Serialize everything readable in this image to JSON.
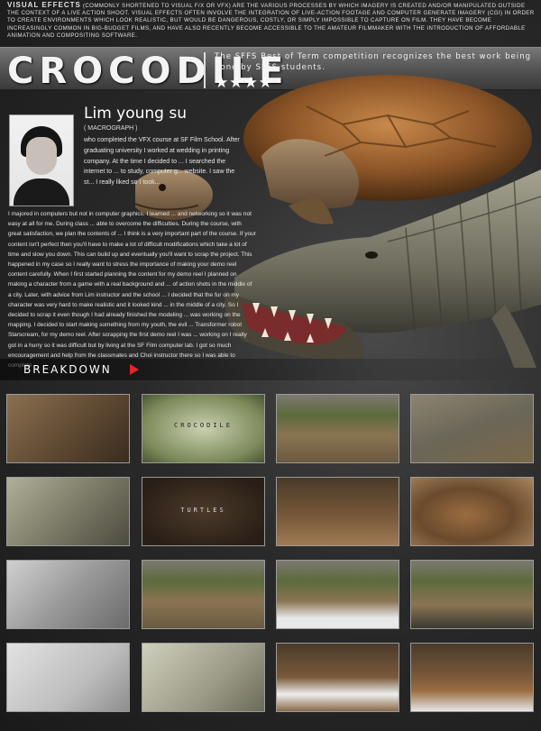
{
  "intro": {
    "lead": "Visual effects",
    "text": "(commonly shortened to visual f/x or vfx) are the various processes by which imagery is created and/or manipulated outside the context of a live action shoot. Visual effects often involve the integration of live-action footage and computer generate imagery (CGI) in order to create environments which look realistic, but would be dangerous, costly, or simply impossible to capture on film. They have become increasingly common in big-budget films, and have also recently become accessible to the amateur filmmaker with the introduction of affordable animation and compositing software."
  },
  "header": {
    "title": "CROCODILE",
    "tagline": "The SFFS Best of Term competition recognizes the best work being done by SFFS students.",
    "stars": "★★★★"
  },
  "profile": {
    "name": "Lim young su",
    "role": "( MACROGRAPH )",
    "bio_short": "who completed the VFX course at SF Film School. After graduating university I worked at wedding in printing company. At the time I decided to ... I searched the internet to ... to study, computer g... website. I saw the st... I really liked so I took...",
    "bio_long": "I majored in computers but not in computer graphics. I learned ... and networking so it was not easy at all for me. During class ... able to overcome the difficulties. During the course, with great satisfaction, we plan the contents of ... I think is a very important part of the course. If your content isn't perfect then you'll have to make a lot of difficult modifications which take a lot of time and slow you down. This can build up and eventually you'll want to scrap the project. This happened in my case so I really want to stress the importance of making your demo reel content carefully. When I first started planning the content for my demo reel I planned on making a character from a game with a real background and ... of action shots in the middle of a city. Later, with advice from Lim instructor and the school ... I decided that the fur on my character was very hard to make realistic and it looked kind ... in the middle of a city. So I decided to scrap it even though I had already finished the modeling ... was working on the mapping. I decided to start making something from my youth, the evil ... Transformer robot Starscream, for my demo reel. After scrapping the first demo reel I was ... working on I really got in a hurry so it was difficult but by living at the SF Film computer lab. I got so much encouragement and help from the classmates and Choi instructor there so I was able to complete"
  },
  "breakdown": {
    "label": "BREAKDOWN"
  },
  "thumbnails": [
    {
      "label": "",
      "style": "tail"
    },
    {
      "label": "CROCODILE",
      "style": "titlecard-green"
    },
    {
      "label": "",
      "style": "scene-plants"
    },
    {
      "label": "",
      "style": "scene-crocs"
    },
    {
      "label": "",
      "style": "croc-leg"
    },
    {
      "label": "TURTLES",
      "style": "titlecard-brown"
    },
    {
      "label": "",
      "style": "scene-turtle-small"
    },
    {
      "label": "",
      "style": "scene-turtle-big"
    },
    {
      "label": "",
      "style": "clay-tail"
    },
    {
      "label": "",
      "style": "scene-plants"
    },
    {
      "label": "",
      "style": "scene-plants-white"
    },
    {
      "label": "",
      "style": "scene-plants-croc"
    },
    {
      "label": "",
      "style": "clay-foot"
    },
    {
      "label": "",
      "style": "croc-foot"
    },
    {
      "label": "",
      "style": "scene-white-turtle"
    },
    {
      "label": "",
      "style": "scene-turtle-white"
    }
  ]
}
